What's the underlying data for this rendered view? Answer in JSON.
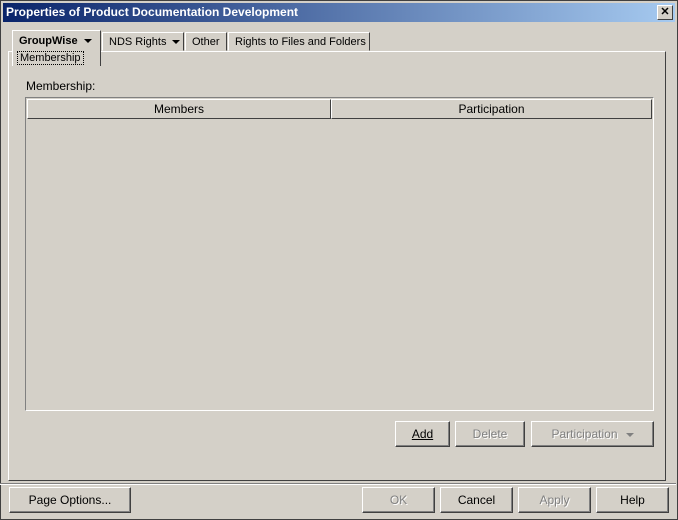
{
  "window": {
    "title": "Properties of Product Documentation Development",
    "close_glyph": "✕"
  },
  "tabs": [
    {
      "label": "GroupWise",
      "sub_label": "Membership",
      "active": true,
      "has_dropdown": true
    },
    {
      "label": "NDS Rights",
      "has_dropdown": true
    },
    {
      "label": "Other"
    },
    {
      "label": "Rights to Files and Folders"
    }
  ],
  "membership": {
    "label": "Membership:",
    "columns": [
      "Members",
      "Participation"
    ],
    "rows": []
  },
  "panel_buttons": {
    "add": "Add",
    "delete": "Delete",
    "participation": "Participation"
  },
  "footer_buttons": {
    "page_options": "Page Options...",
    "ok": "OK",
    "cancel": "Cancel",
    "apply": "Apply",
    "help": "Help"
  },
  "colors": {
    "titlebar_start": "#0a246a",
    "titlebar_end": "#a6caf0",
    "face": "#d4d0c8"
  }
}
